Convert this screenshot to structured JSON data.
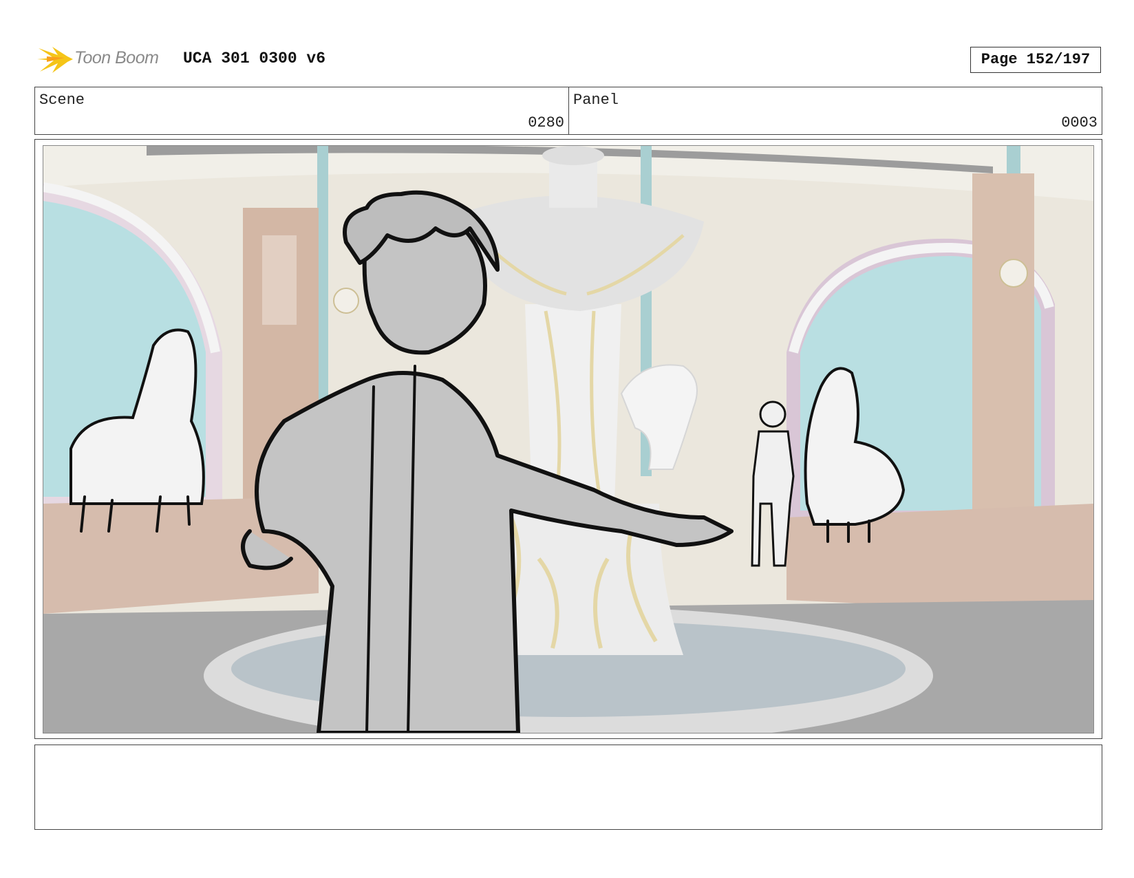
{
  "header": {
    "brand": "Toon Boom",
    "title": "UCA 301 0300 v6",
    "page": "Page 152/197"
  },
  "info": {
    "scene_label": "Scene",
    "scene_value": "0280",
    "panel_label": "Panel",
    "panel_value": "0003"
  },
  "notes": {
    "text": ""
  },
  "colors": {
    "logo_yellow": "#f5c518",
    "wall": "#ece8de",
    "window": "#b5dde0",
    "wood": "#d8bfae",
    "floor": "#a9a9a9",
    "character_fill": "#c4c4c4",
    "fountain": "#e6e6e6",
    "gold_trim": "#e8dcb0"
  }
}
